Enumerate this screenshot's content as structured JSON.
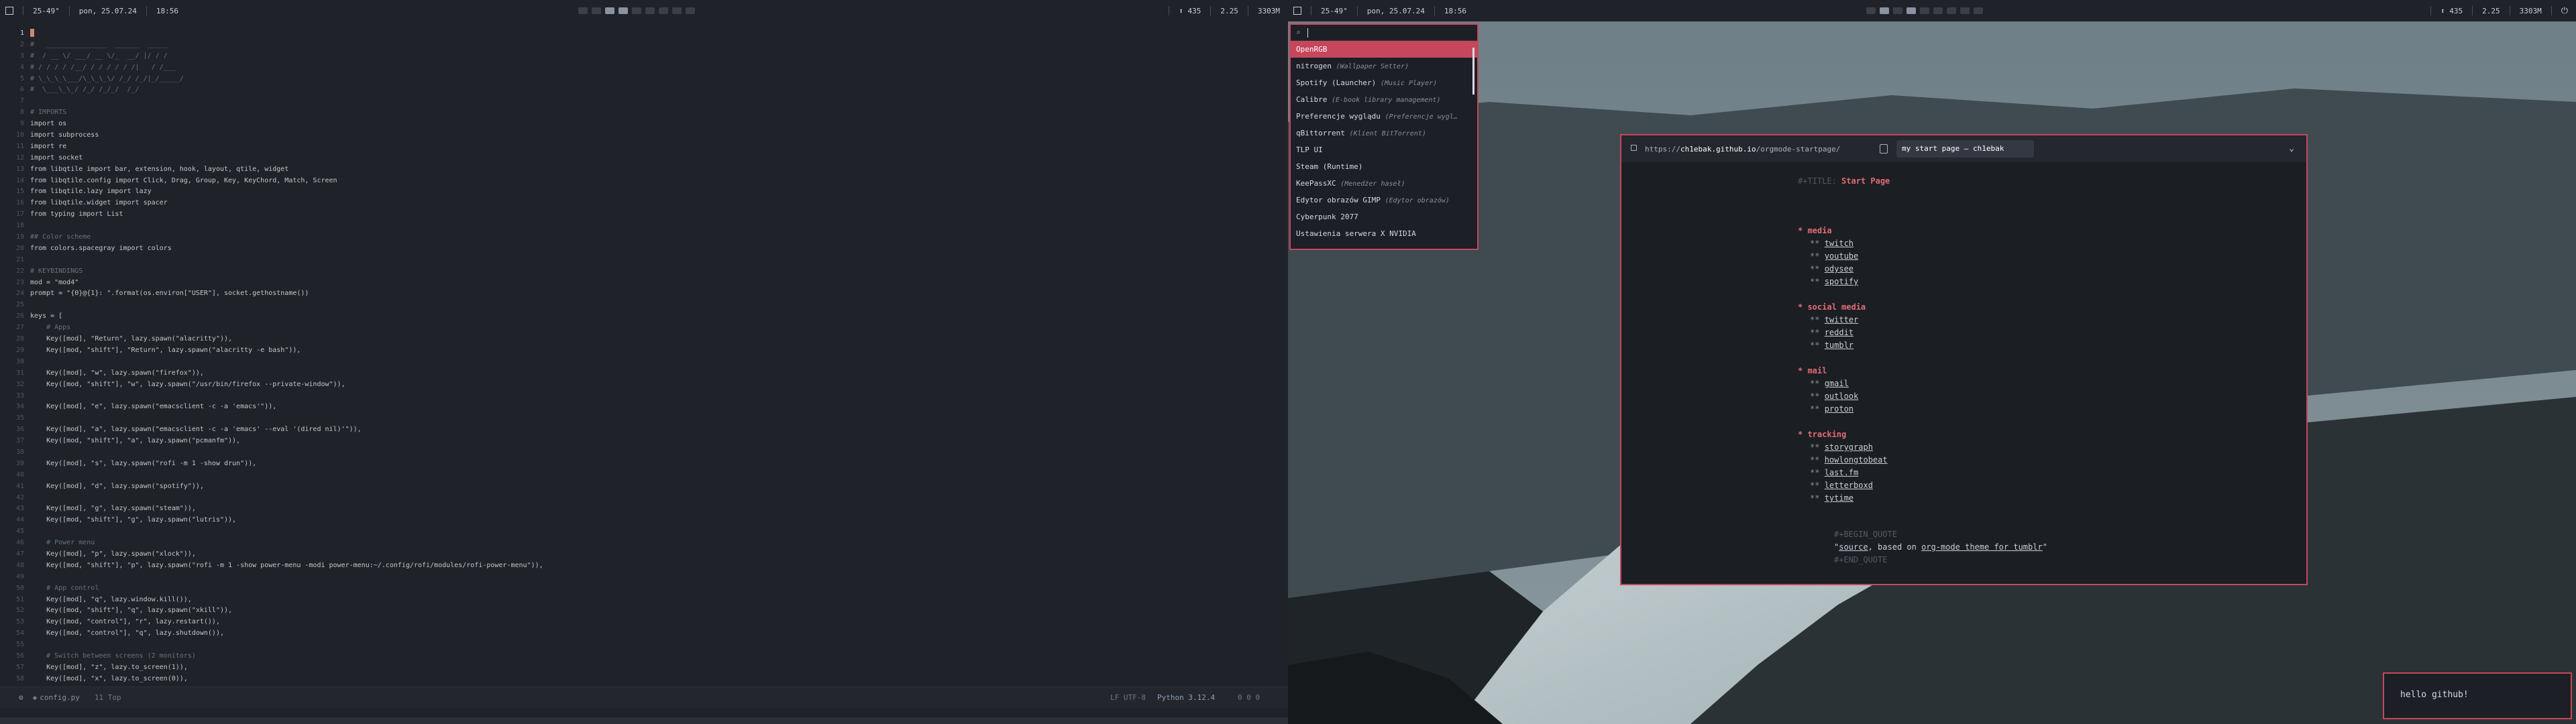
{
  "left_bar": {
    "temp": "25-49°",
    "date": "pon, 25.07.24",
    "time": "18:56",
    "updates": "435",
    "load": "2.25",
    "mem": "3303M"
  },
  "right_bar": {
    "temp": "25-49°",
    "date": "pon, 25.07.24",
    "time": "18:56",
    "updates": "435",
    "load": "2.25",
    "mem": "3303M"
  },
  "editor": {
    "lines": [
      {
        "t": "",
        "c": "cursor"
      },
      {
        "t": "#   _______________  ______  _____",
        "c": "comment"
      },
      {
        "t": "#  / __ \\/ ___/ __ \\/_  __/ |/ / /",
        "c": "comment"
      },
      {
        "t": "# / / / / /__/ / / / / / /|   / /___",
        "c": "comment"
      },
      {
        "t": "# \\_\\_\\_\\___/\\_\\_\\_\\/ /_/ /_/|_/_____/",
        "c": "comment"
      },
      {
        "t": "#  \\___\\_\\_/ /_/ /_/_/  /_/      ",
        "c": "comment"
      },
      {
        "t": "",
        "c": ""
      },
      {
        "t": "# IMPORTS",
        "c": "comment"
      },
      {
        "t": "import os",
        "c": "code"
      },
      {
        "t": "import subprocess",
        "c": "code"
      },
      {
        "t": "import re",
        "c": "code"
      },
      {
        "t": "import socket",
        "c": "code"
      },
      {
        "t": "from libqtile import bar, extension, hook, layout, qtile, widget",
        "c": "code"
      },
      {
        "t": "from libqtile.config import Click, Drag, Group, Key, KeyChord, Match, Screen",
        "c": "code"
      },
      {
        "t": "from libqtile.lazy import lazy",
        "c": "code"
      },
      {
        "t": "from libqtile.widget import spacer",
        "c": "code"
      },
      {
        "t": "from typing import List",
        "c": "code"
      },
      {
        "t": "",
        "c": ""
      },
      {
        "t": "## Color scheme",
        "c": "comment"
      },
      {
        "t": "from colors.spacegray import colors",
        "c": "code"
      },
      {
        "t": "",
        "c": ""
      },
      {
        "t": "# KEYBINDINGS",
        "c": "comment"
      },
      {
        "t": "mod = \"mod4\"",
        "c": "code"
      },
      {
        "t": "prompt = \"{0}@{1}: \".format(os.environ[\"USER\"], socket.gethostname())",
        "c": "code"
      },
      {
        "t": "",
        "c": ""
      },
      {
        "t": "keys = [",
        "c": "code"
      },
      {
        "t": "    # Apps",
        "c": "comment"
      },
      {
        "t": "    Key([mod], \"Return\", lazy.spawn(\"alacritty\")),",
        "c": "code"
      },
      {
        "t": "    Key([mod, \"shift\"], \"Return\", lazy.spawn(\"alacritty -e bash\")),",
        "c": "code"
      },
      {
        "t": "",
        "c": ""
      },
      {
        "t": "    Key([mod], \"w\", lazy.spawn(\"firefox\")),",
        "c": "code"
      },
      {
        "t": "    Key([mod, \"shift\"], \"w\", lazy.spawn(\"/usr/bin/firefox --private-window\")),",
        "c": "code"
      },
      {
        "t": "",
        "c": ""
      },
      {
        "t": "    Key([mod], \"e\", lazy.spawn(\"emacsclient -c -a 'emacs'\")),",
        "c": "code"
      },
      {
        "t": "",
        "c": ""
      },
      {
        "t": "    Key([mod], \"a\", lazy.spawn(\"emacsclient -c -a 'emacs' --eval '(dired nil)'\")),",
        "c": "code"
      },
      {
        "t": "    Key([mod, \"shift\"], \"a\", lazy.spawn(\"pcmanfm\")),",
        "c": "code"
      },
      {
        "t": "",
        "c": ""
      },
      {
        "t": "    Key([mod], \"s\", lazy.spawn(\"rofi -m 1 -show drun\")),",
        "c": "code"
      },
      {
        "t": "",
        "c": ""
      },
      {
        "t": "    Key([mod], \"d\", lazy.spawn(\"spotify\")),",
        "c": "code"
      },
      {
        "t": "",
        "c": ""
      },
      {
        "t": "    Key([mod], \"g\", lazy.spawn(\"steam\")),",
        "c": "code"
      },
      {
        "t": "    Key([mod, \"shift\"], \"g\", lazy.spawn(\"lutris\")),",
        "c": "code"
      },
      {
        "t": "",
        "c": ""
      },
      {
        "t": "    # Power menu",
        "c": "comment"
      },
      {
        "t": "    Key([mod], \"p\", lazy.spawn(\"xlock\")),",
        "c": "code"
      },
      {
        "t": "    Key([mod, \"shift\"], \"p\", lazy.spawn(\"rofi -m 1 -show power-menu -modi power-menu:~/.config/rofi/modules/rofi-power-menu\")),",
        "c": "code"
      },
      {
        "t": "",
        "c": ""
      },
      {
        "t": "    # App control",
        "c": "comment"
      },
      {
        "t": "    Key([mod], \"q\", lazy.window.kill()),",
        "c": "code"
      },
      {
        "t": "    Key([mod, \"shift\"], \"q\", lazy.spawn(\"xkill\")),",
        "c": "code"
      },
      {
        "t": "    Key([mod, \"control\"], \"r\", lazy.restart()),",
        "c": "code"
      },
      {
        "t": "    Key([mod, \"control\"], \"q\", lazy.shutdown()),",
        "c": "code"
      },
      {
        "t": "",
        "c": ""
      },
      {
        "t": "    # Switch between screens (2 monitors)",
        "c": "comment"
      },
      {
        "t": "    Key([mod], \"z\", lazy.to_screen(1)),",
        "c": "code"
      },
      {
        "t": "    Key([mod], \"x\", lazy.to_screen(0)),",
        "c": "code"
      },
      {
        "t": "",
        "c": ""
      }
    ],
    "modeline": {
      "file": "config.py",
      "pos": "11 Top",
      "encoding": "LF UTF-8",
      "lang": "Python 3.12.4",
      "diag": "0 0 0"
    }
  },
  "rofi": {
    "items": [
      {
        "name": "OpenRGB",
        "sub": ""
      },
      {
        "name": "nitrogen",
        "sub": "(Wallpaper Setter)"
      },
      {
        "name": "Spotify (Launcher)",
        "sub": "(Music Player)"
      },
      {
        "name": "Calibre",
        "sub": "(E-book library management)"
      },
      {
        "name": "Preferencje wyglądu",
        "sub": "(Preferencje wygl…"
      },
      {
        "name": "qBittorrent",
        "sub": "(Klient BitTorrent)"
      },
      {
        "name": "TLP UI",
        "sub": ""
      },
      {
        "name": "Steam (Runtime)",
        "sub": ""
      },
      {
        "name": "KeePassXC",
        "sub": "(Menedżer haseł)"
      },
      {
        "name": "Edytor obrazów GIMP",
        "sub": "(Edytor obrazów)"
      },
      {
        "name": "Cyberpunk 2077",
        "sub": ""
      },
      {
        "name": "Ustawienia serwera X NVIDIA",
        "sub": ""
      }
    ]
  },
  "browser": {
    "url_prefix": "https://",
    "url_host": "ch1ebak.github.io",
    "url_path": "/orgmode-startpage/",
    "tab_title": "my start page — ch1ebak",
    "page": {
      "title_key": "#+TITLE:",
      "title": "Start Page",
      "sections": [
        {
          "name": "media",
          "links": [
            "twitch",
            "youtube",
            "odysee",
            "spotify"
          ]
        },
        {
          "name": "social media",
          "links": [
            "twitter",
            "reddit",
            "tumblr"
          ]
        },
        {
          "name": "mail",
          "links": [
            "gmail",
            "outlook",
            "proton"
          ]
        },
        {
          "name": "tracking",
          "links": [
            "storygraph",
            "howlongtobeat",
            "last.fm",
            "letterboxd",
            "tytime"
          ]
        }
      ],
      "quote_begin": "#+BEGIN_QUOTE",
      "quote_link1": "source",
      "quote_mid": ", based on ",
      "quote_link2": "org-mode theme for tumblr",
      "quote_end": "#+END_QUOTE"
    }
  },
  "toast": {
    "text": "hello github!"
  },
  "colors": {
    "accent": "#c6475b",
    "heading": "#e06c75",
    "comment": "#65737e"
  }
}
